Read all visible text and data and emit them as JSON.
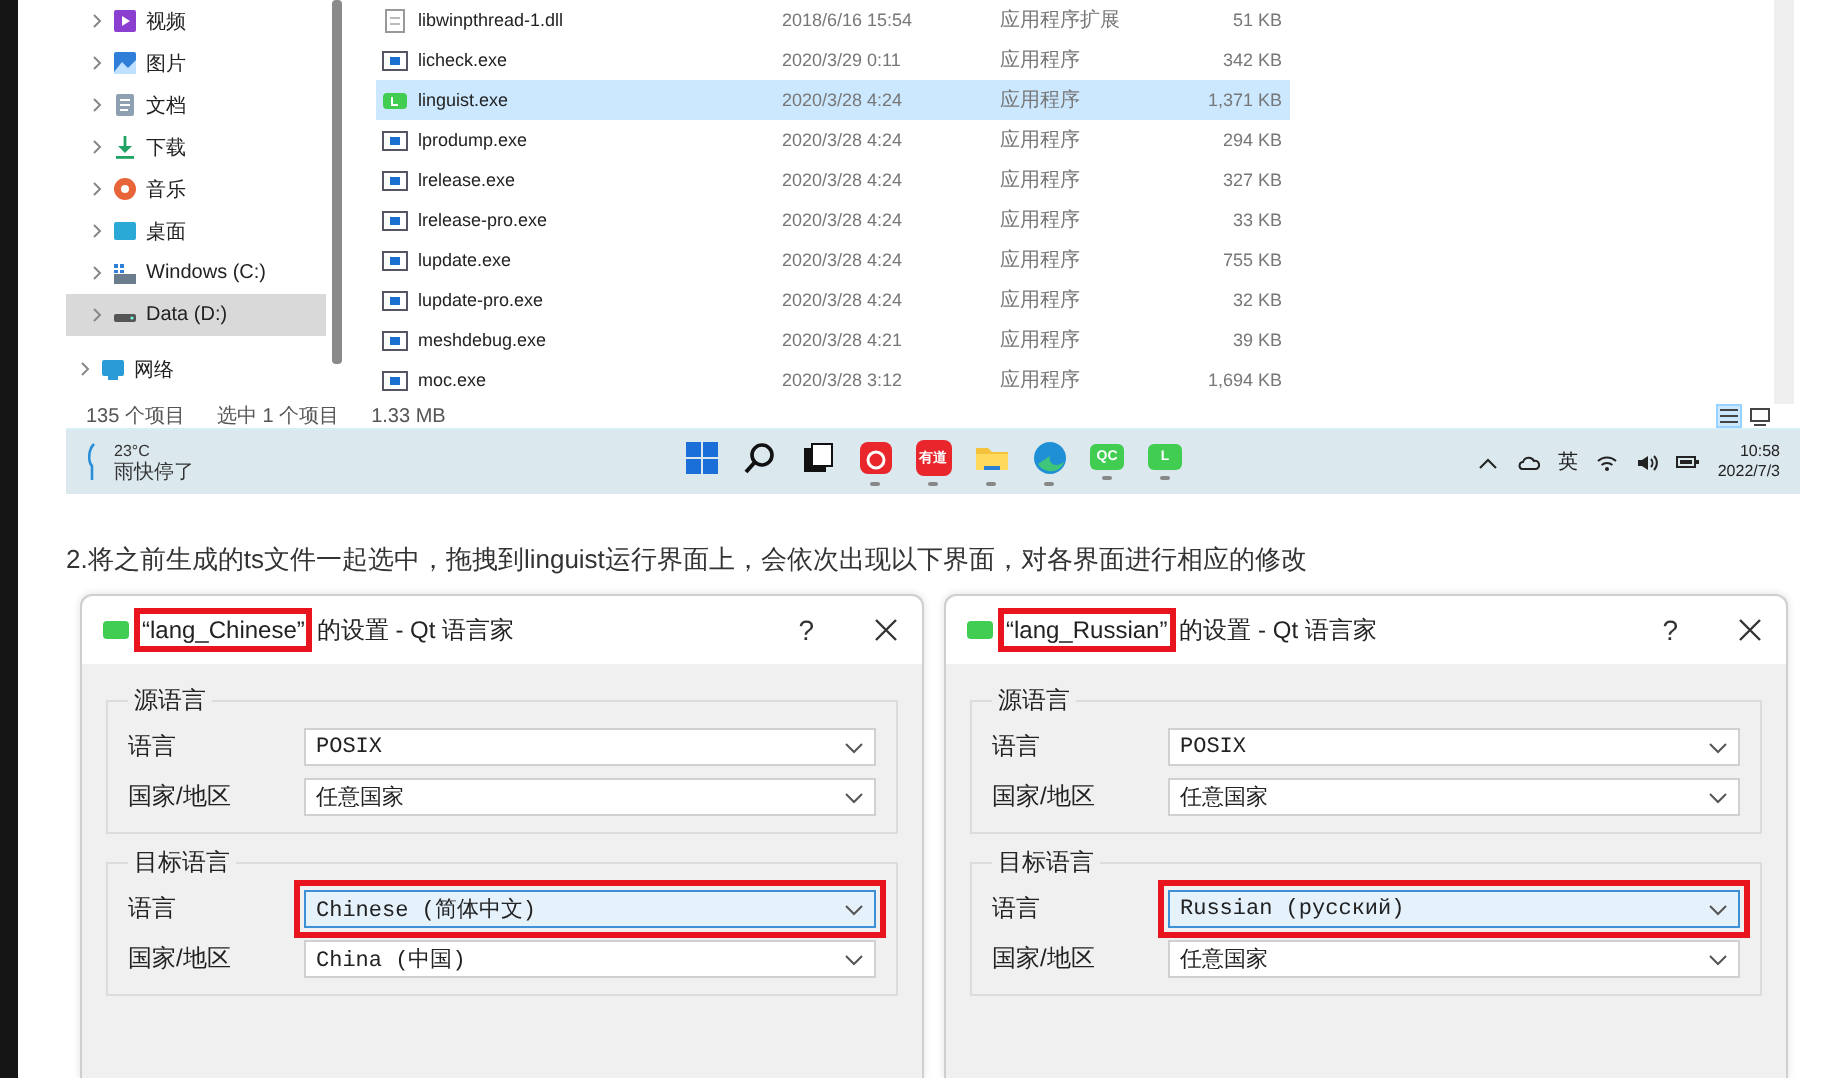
{
  "explorer": {
    "nav_items": [
      {
        "label": "视频",
        "kind": "video",
        "selected": false
      },
      {
        "label": "图片",
        "kind": "picture",
        "selected": false
      },
      {
        "label": "文档",
        "kind": "document",
        "selected": false
      },
      {
        "label": "下载",
        "kind": "download",
        "selected": false
      },
      {
        "label": "音乐",
        "kind": "music",
        "selected": false
      },
      {
        "label": "桌面",
        "kind": "desktop",
        "selected": false
      },
      {
        "label": "Windows (C:)",
        "kind": "system",
        "selected": false
      },
      {
        "label": "Data (D:)",
        "kind": "drive",
        "selected": true
      },
      {
        "label": "网络",
        "kind": "network",
        "selected": false
      }
    ],
    "files": [
      {
        "name": "libwinpthread-1.dll",
        "date": "2018/6/16 15:54",
        "type": "应用程序扩展",
        "size": "51 KB",
        "kind": "dll",
        "selected": false
      },
      {
        "name": "licheck.exe",
        "date": "2020/3/29 0:11",
        "type": "应用程序",
        "size": "342 KB",
        "kind": "exe",
        "selected": false
      },
      {
        "name": "linguist.exe",
        "date": "2020/3/28 4:24",
        "type": "应用程序",
        "size": "1,371 KB",
        "kind": "linguist",
        "selected": true
      },
      {
        "name": "lprodump.exe",
        "date": "2020/3/28 4:24",
        "type": "应用程序",
        "size": "294 KB",
        "kind": "exe",
        "selected": false
      },
      {
        "name": "lrelease.exe",
        "date": "2020/3/28 4:24",
        "type": "应用程序",
        "size": "327 KB",
        "kind": "exe",
        "selected": false
      },
      {
        "name": "lrelease-pro.exe",
        "date": "2020/3/28 4:24",
        "type": "应用程序",
        "size": "33 KB",
        "kind": "exe",
        "selected": false
      },
      {
        "name": "lupdate.exe",
        "date": "2020/3/28 4:24",
        "type": "应用程序",
        "size": "755 KB",
        "kind": "exe",
        "selected": false
      },
      {
        "name": "lupdate-pro.exe",
        "date": "2020/3/28 4:24",
        "type": "应用程序",
        "size": "32 KB",
        "kind": "exe",
        "selected": false
      },
      {
        "name": "meshdebug.exe",
        "date": "2020/3/28 4:21",
        "type": "应用程序",
        "size": "39 KB",
        "kind": "exe",
        "selected": false
      },
      {
        "name": "moc.exe",
        "date": "2020/3/28 3:12",
        "type": "应用程序",
        "size": "1,694 KB",
        "kind": "exe",
        "selected": false
      }
    ],
    "status_bar": {
      "item_count": "135 个项目",
      "selection": "选中 1 个项目",
      "selection_size": "1.33 MB"
    },
    "view_buttons": [
      {
        "kind": "details",
        "selected": true
      },
      {
        "kind": "tiles",
        "selected": false
      }
    ]
  },
  "taskbar": {
    "weather": {
      "temperature": "23°C",
      "condition": "雨快停了"
    },
    "apps": [
      {
        "kind": "start",
        "running": false
      },
      {
        "kind": "search",
        "running": false
      },
      {
        "kind": "taskview",
        "running": false
      },
      {
        "kind": "music",
        "running": true
      },
      {
        "kind": "youdao",
        "label": "有道",
        "running": true
      },
      {
        "kind": "folder",
        "running": true
      },
      {
        "kind": "edge",
        "running": true
      },
      {
        "kind": "qc",
        "label": "QC",
        "running": true
      },
      {
        "kind": "linguist",
        "label": "L",
        "running": true
      }
    ],
    "input_method": "英",
    "time": "10:58",
    "date": "2022/7/3"
  },
  "instruction": "2.将之前生成的ts文件一起选中，拖拽到linguist运行界面上，会依次出现以下界面，对各界面进行相应的修改",
  "dialogs": [
    {
      "title_parts": [
        {
          "text": "“lang_Chinese”",
          "annotated": true
        },
        {
          "text": "的设置 - Qt 语言家",
          "annotated": false
        }
      ],
      "help": "?",
      "groups": [
        {
          "title": "源语言",
          "rows": [
            {
              "label": "语言",
              "value": "POSIX",
              "focused": false,
              "annotated": false
            },
            {
              "label": "国家/地区",
              "value": "任意国家",
              "focused": false,
              "annotated": false
            }
          ]
        },
        {
          "title": "目标语言",
          "rows": [
            {
              "label": "语言",
              "value": "Chinese (简体中文)",
              "focused": true,
              "annotated": true
            },
            {
              "label": "国家/地区",
              "value": "China (中国)",
              "focused": false,
              "annotated": false
            }
          ]
        }
      ]
    },
    {
      "title_parts": [
        {
          "text": "“lang_Russian”",
          "annotated": true
        },
        {
          "text": "的设置 - Qt 语言家",
          "annotated": false
        }
      ],
      "help": "?",
      "groups": [
        {
          "title": "源语言",
          "rows": [
            {
              "label": "语言",
              "value": "POSIX",
              "focused": false,
              "annotated": false
            },
            {
              "label": "国家/地区",
              "value": "任意国家",
              "focused": false,
              "annotated": false
            }
          ]
        },
        {
          "title": "目标语言",
          "rows": [
            {
              "label": "语言",
              "value": "Russian (русский)",
              "focused": true,
              "annotated": true
            },
            {
              "label": "国家/地区",
              "value": "任意国家",
              "focused": false,
              "annotated": false
            }
          ]
        }
      ]
    }
  ]
}
